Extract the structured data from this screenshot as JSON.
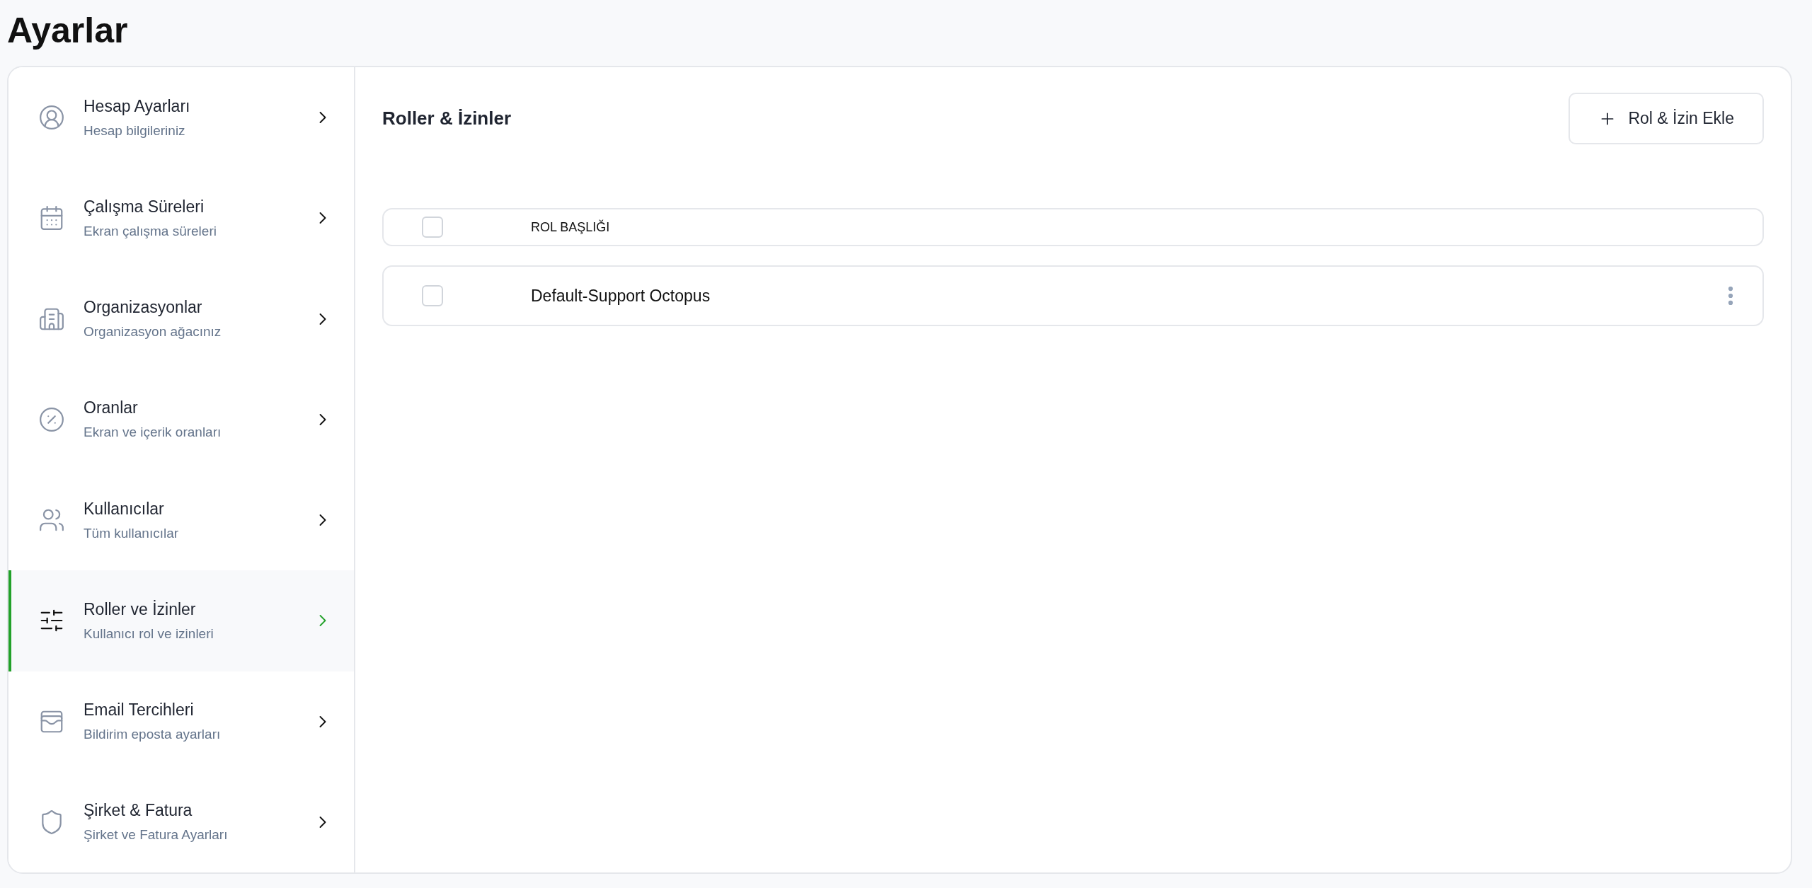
{
  "page_title": "Ayarlar",
  "sidebar": {
    "items": [
      {
        "title": "Hesap Ayarları",
        "subtitle": "Hesap bilgileriniz",
        "selected": false
      },
      {
        "title": "Çalışma Süreleri",
        "subtitle": "Ekran çalışma süreleri",
        "selected": false
      },
      {
        "title": "Organizasyonlar",
        "subtitle": "Organizasyon ağacınız",
        "selected": false
      },
      {
        "title": "Oranlar",
        "subtitle": "Ekran ve içerik oranları",
        "selected": false
      },
      {
        "title": "Kullanıcılar",
        "subtitle": "Tüm kullanıcılar",
        "selected": false
      },
      {
        "title": "Roller ve İzinler",
        "subtitle": "Kullanıcı rol ve izinleri",
        "selected": true
      },
      {
        "title": "Email Tercihleri",
        "subtitle": "Bildirim eposta ayarları",
        "selected": false
      },
      {
        "title": "Şirket & Fatura",
        "subtitle": "Şirket ve Fatura Ayarları",
        "selected": false
      }
    ]
  },
  "panel": {
    "title": "Roller & İzinler",
    "add_button": "Rol & İzin Ekle",
    "table": {
      "columns": [
        "ROL BAŞLIĞI"
      ],
      "header_checked": false,
      "rows": [
        {
          "title": "Default-Support Octopus",
          "checked": false
        }
      ]
    }
  }
}
